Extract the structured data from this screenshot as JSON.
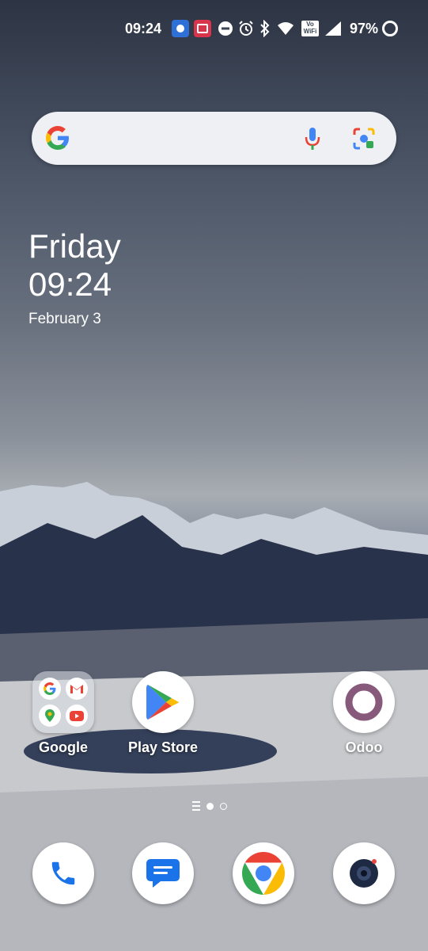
{
  "status_bar": {
    "time": "09:24",
    "battery": "97%",
    "icons": [
      "focus-mode-icon",
      "screen-record-icon",
      "do-not-disturb-icon",
      "alarm-icon",
      "bluetooth-icon",
      "wifi-icon",
      "vowifi-icon",
      "signal-icon",
      "battery-icon"
    ],
    "vowifi_text": "Vo\nWiFi"
  },
  "search_bar": {
    "icons": [
      "google-logo-icon",
      "microphone-icon",
      "lens-camera-icon"
    ]
  },
  "clock_widget": {
    "day": "Friday",
    "time": "09:24",
    "date": "February 3"
  },
  "apps": [
    {
      "label": "Google",
      "icon": "google-folder-icon"
    },
    {
      "label": "Play Store",
      "icon": "play-store-icon"
    },
    {
      "label": "Odoo",
      "icon": "odoo-icon"
    }
  ],
  "dock": [
    {
      "icon": "phone-icon"
    },
    {
      "icon": "messages-icon"
    },
    {
      "icon": "chrome-icon"
    },
    {
      "icon": "camera-icon"
    }
  ],
  "colors": {
    "google_blue": "#4285F4",
    "google_red": "#EA4335",
    "google_yellow": "#FBBC05",
    "google_green": "#34A853",
    "odoo_purple": "#875A7B"
  }
}
